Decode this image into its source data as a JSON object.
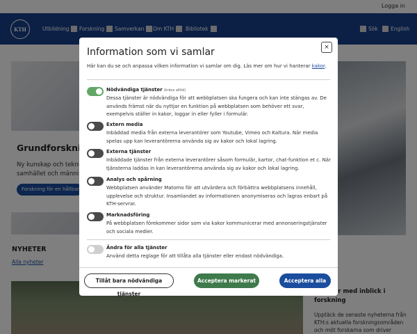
{
  "topbar": {
    "login": "Logga in"
  },
  "nav": {
    "logo_text": "KTH",
    "items": [
      "Utbildning",
      "Forskning",
      "Samverkan",
      "Om KTH",
      "Bibliotek"
    ],
    "search": "Sök",
    "language": "English"
  },
  "page": {
    "hero_title": "Grundforskning",
    "hero_text_1": "Ny kunskap och tekni",
    "hero_text_2": "samhället och männis",
    "hero_button": "Forskning för en hållbar",
    "news_title": "NYHETER",
    "news_link": "Alla nyheter",
    "news_side_title": "Nyheter med inblick i forskning",
    "news_side_text": "Upptäck de senaste nyheterna från KTH:s aktuella forskningsområden och möt forskarna som driver utvecklingen"
  },
  "modal": {
    "title": "Information som vi samlar",
    "close_label": "×",
    "intro_text": "Här kan du se och anpassa vilken information vi samlar om dig. Läs mer om hur vi hanterar",
    "intro_link": "kakor",
    "intro_end": ".",
    "options": [
      {
        "title": "Nödvändiga tjänster",
        "note": "(krävs alltid)",
        "state": "on",
        "description": "Dessa tjänster är nödvändiga för att webbplatsen ska fungera och kan inte stängas av. De används främst när du nyttjar en funktion på webbplatsen som behöver ett svar, exempelvis ställer in kakor, loggar in eller fyller i formulär."
      },
      {
        "title": "Extern media",
        "note": "",
        "state": "off",
        "description": "Inbäddad media från externa leverantörer som Youtube, Vimeo och Kaltura. När media spelas upp kan leverantörerna använda sig av kakor och lokal lagring."
      },
      {
        "title": "Externa tjänster",
        "note": "",
        "state": "off",
        "description": "Inbäddade tjänster från externa leverantörer såsom formulär, kartor, chat-funktion et c. När tjänsterna laddas in kan leverantörerna använda sig av kakor och lokal lagring."
      },
      {
        "title": "Analys och spårning",
        "note": "",
        "state": "off",
        "description": "Webbplatsen använder Matomo för att utvärdera och förbättra webbplatsens innehåll, upplevelse och struktur. Insamlandet av informationen anonymiseras och lagras enbart på KTH-servrar."
      },
      {
        "title": "Marknadsföring",
        "note": "",
        "state": "off",
        "description": "På webbplatsen förekommer sidor som via kakor kommunicerar med annonseringstjänster och sociala medier."
      }
    ],
    "all_toggle": {
      "title": "Ändra för alla tjänster",
      "state": "disabled",
      "description": "Använd detta reglage för att tillåta alla tjänster eller endast nödvändiga."
    },
    "buttons": {
      "necessary_only": "Tillåt bara nödvändiga tjänster",
      "accept_selected": "Acceptera markerat",
      "accept_all": "Acceptera alla"
    }
  },
  "colors": {
    "nav_bg": "#18418c",
    "toggle_on": "#62a766",
    "toggle_off": "#4a4a4a",
    "btn_green": "#3e7a4b",
    "btn_blue": "#1a4d9e"
  }
}
